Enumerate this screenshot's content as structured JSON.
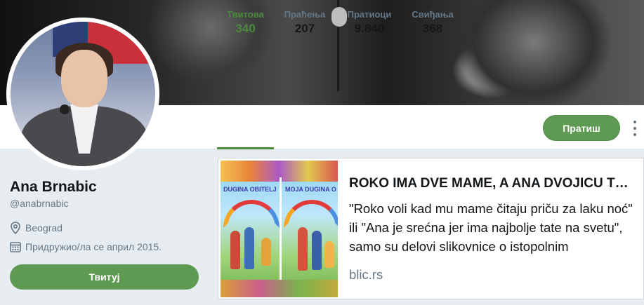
{
  "profile": {
    "name": "Ana Brnabic",
    "handle": "@anabrnabic",
    "location": "Beograd",
    "joined": "Придружио/ла се април 2015."
  },
  "stats": [
    {
      "label": "Твитова",
      "value": "340"
    },
    {
      "label": "Праћења",
      "value": "207"
    },
    {
      "label": "Пратиоци",
      "value": "9.840"
    },
    {
      "label": "Свиђања",
      "value": "368"
    }
  ],
  "buttons": {
    "follow": "Пратиш",
    "tweet": "Твитуј"
  },
  "card": {
    "title": "ROKO IMA DVE MAME, A ANA DVOJICU T…",
    "description": "\"Roko voli kad mu mame čitaju priču za laku noć\" ili \"Ana je srećna jer ima najbolje tate na svetu\", samo su delovi slikovnice o istopolnim",
    "domain": "blic.rs",
    "thumb_left_title": "DUGINA OBITELJ",
    "thumb_right_title": "MOJA DUGINA O"
  },
  "colors": {
    "accent": "#5e9a52",
    "active_stat": "#4a8a3d",
    "muted": "#657786",
    "background": "#e6ecf0"
  },
  "icons": {
    "location": "location-pin-icon",
    "calendar": "calendar-icon",
    "more": "more-vertical-icon"
  }
}
